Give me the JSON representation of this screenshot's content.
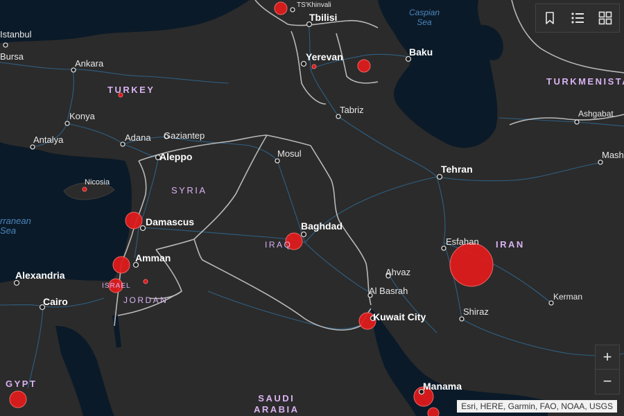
{
  "map": {
    "cities": [
      {
        "id": "tskhinvali",
        "name": "TS'Khinvali",
        "style": "small"
      },
      {
        "id": "tbilisi",
        "name": "Tbilisi",
        "style": "major"
      },
      {
        "id": "istanbul",
        "name": "Istanbul",
        "style": "normal"
      },
      {
        "id": "bursa",
        "name": "Bursa",
        "style": "normal"
      },
      {
        "id": "ankara",
        "name": "Ankara",
        "style": "normal"
      },
      {
        "id": "yerevan",
        "name": "Yerevan",
        "style": "major"
      },
      {
        "id": "baku",
        "name": "Baku",
        "style": "major"
      },
      {
        "id": "konya",
        "name": "Konya",
        "style": "normal"
      },
      {
        "id": "tabriz",
        "name": "Tabriz",
        "style": "normal"
      },
      {
        "id": "ashgabat",
        "name": "Ashgabat",
        "style": "normal"
      },
      {
        "id": "antalya",
        "name": "Antalya",
        "style": "normal"
      },
      {
        "id": "adana",
        "name": "Adana",
        "style": "normal"
      },
      {
        "id": "gaziantep",
        "name": "Gaziantep",
        "style": "normal"
      },
      {
        "id": "aleppo",
        "name": "Aleppo",
        "style": "major"
      },
      {
        "id": "mosul",
        "name": "Mosul",
        "style": "normal"
      },
      {
        "id": "mashhad",
        "name": "Mash",
        "style": "normal"
      },
      {
        "id": "tehran",
        "name": "Tehran",
        "style": "major"
      },
      {
        "id": "nicosia",
        "name": "Nicosia",
        "style": "small"
      },
      {
        "id": "damascus",
        "name": "Damascus",
        "style": "major"
      },
      {
        "id": "baghdad",
        "name": "Baghdad",
        "style": "major"
      },
      {
        "id": "esfahan",
        "name": "Esfahan",
        "style": "normal"
      },
      {
        "id": "amman",
        "name": "Amman",
        "style": "major"
      },
      {
        "id": "ahvaz",
        "name": "Ahvaz",
        "style": "normal"
      },
      {
        "id": "alexandria",
        "name": "Alexandria",
        "style": "major"
      },
      {
        "id": "albasrah",
        "name": "Al Basrah",
        "style": "normal"
      },
      {
        "id": "kerman",
        "name": "Kerman",
        "style": "small"
      },
      {
        "id": "cairo",
        "name": "Cairo",
        "style": "major"
      },
      {
        "id": "shiraz",
        "name": "Shiraz",
        "style": "normal"
      },
      {
        "id": "kuwaitcity",
        "name": "Kuwait City",
        "style": "major"
      },
      {
        "id": "manama",
        "name": "Manama",
        "style": "major"
      }
    ],
    "countries": [
      {
        "id": "turkey",
        "name": "TURKEY"
      },
      {
        "id": "turkmenistan",
        "name": "TURKMENISTA"
      },
      {
        "id": "syria",
        "name": "SYRIA"
      },
      {
        "id": "iraq",
        "name": "IRAQ"
      },
      {
        "id": "iran",
        "name": "IRAN"
      },
      {
        "id": "israel",
        "name": "ISRAEL"
      },
      {
        "id": "jordan",
        "name": "JORDAN"
      },
      {
        "id": "egypt",
        "name": "GYPT"
      },
      {
        "id": "saudi",
        "name": "SAUDI\nARABIA"
      }
    ],
    "water": [
      {
        "id": "caspian",
        "name": "Caspian\nSea"
      },
      {
        "id": "mediterranean",
        "name": "rranean\nSea"
      }
    ],
    "bubble_color": "#e31b1b",
    "land_color": "#2b2b2b",
    "water_color": "#0b1a28",
    "road_color": "#2f6a93",
    "border_color": "#c9c9c9"
  },
  "toolbar": {
    "bookmark_icon": "bookmark-icon",
    "legend_icon": "list-icon",
    "basemap_icon": "grid-icon"
  },
  "zoom": {
    "in_label": "+",
    "out_label": "−"
  },
  "attribution": "Esri, HERE, Garmin, FAO, NOAA, USGS"
}
